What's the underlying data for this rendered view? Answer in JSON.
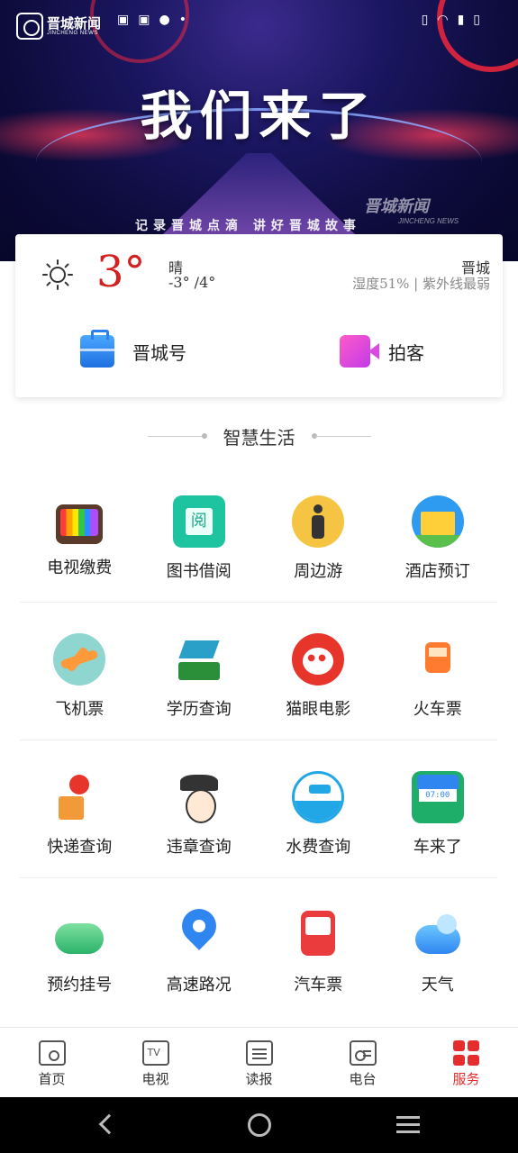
{
  "banner": {
    "logo_cn": "晋城新闻",
    "logo_en": "JINCHENG NEWS",
    "headline": "我们来了",
    "slogan": "记录晋城点滴  讲好晋城故事",
    "watermark_cn": "晋城新闻",
    "watermark_en": "JINCHENG NEWS"
  },
  "weather": {
    "icon": "sun-icon",
    "temperature": "3°",
    "condition": "晴",
    "range": "-3° /4°",
    "city": "晋城",
    "details": "湿度51% | 紫外线最弱"
  },
  "quick_links": [
    {
      "label": "晋城号",
      "icon": "briefcase-icon",
      "color": "#2b80ee"
    },
    {
      "label": "拍客",
      "icon": "video-camera-icon",
      "color": "#d84ae0"
    }
  ],
  "section": {
    "title": "智慧生活"
  },
  "services": [
    [
      {
        "label": "电视缴费",
        "icon": "tv-icon"
      },
      {
        "label": "图书借阅",
        "icon": "book-icon"
      },
      {
        "label": "周边游",
        "icon": "walker-icon"
      },
      {
        "label": "酒店预订",
        "icon": "hotel-icon"
      }
    ],
    [
      {
        "label": "飞机票",
        "icon": "plane-icon"
      },
      {
        "label": "学历查询",
        "icon": "graduation-cap-icon"
      },
      {
        "label": "猫眼电影",
        "icon": "cat-icon"
      },
      {
        "label": "火车票",
        "icon": "train-icon"
      }
    ],
    [
      {
        "label": "快递查询",
        "icon": "delivery-icon"
      },
      {
        "label": "违章查询",
        "icon": "police-icon"
      },
      {
        "label": "水费查询",
        "icon": "water-tap-icon"
      },
      {
        "label": "车来了",
        "icon": "bus-icon"
      }
    ],
    [
      {
        "label": "预约挂号",
        "icon": "cloud-stethoscope-icon"
      },
      {
        "label": "高速路况",
        "icon": "map-pin-icon"
      },
      {
        "label": "汽车票",
        "icon": "coach-icon"
      },
      {
        "label": "天气",
        "icon": "cloud-sun-icon"
      }
    ]
  ],
  "nav": {
    "items": [
      {
        "label": "首页",
        "icon": "home-icon"
      },
      {
        "label": "电视",
        "icon": "tv-icon"
      },
      {
        "label": "读报",
        "icon": "newspaper-icon"
      },
      {
        "label": "电台",
        "icon": "radio-icon"
      },
      {
        "label": "服务",
        "icon": "grid-icon",
        "active": true
      }
    ],
    "active_color": "#e52d2d"
  }
}
